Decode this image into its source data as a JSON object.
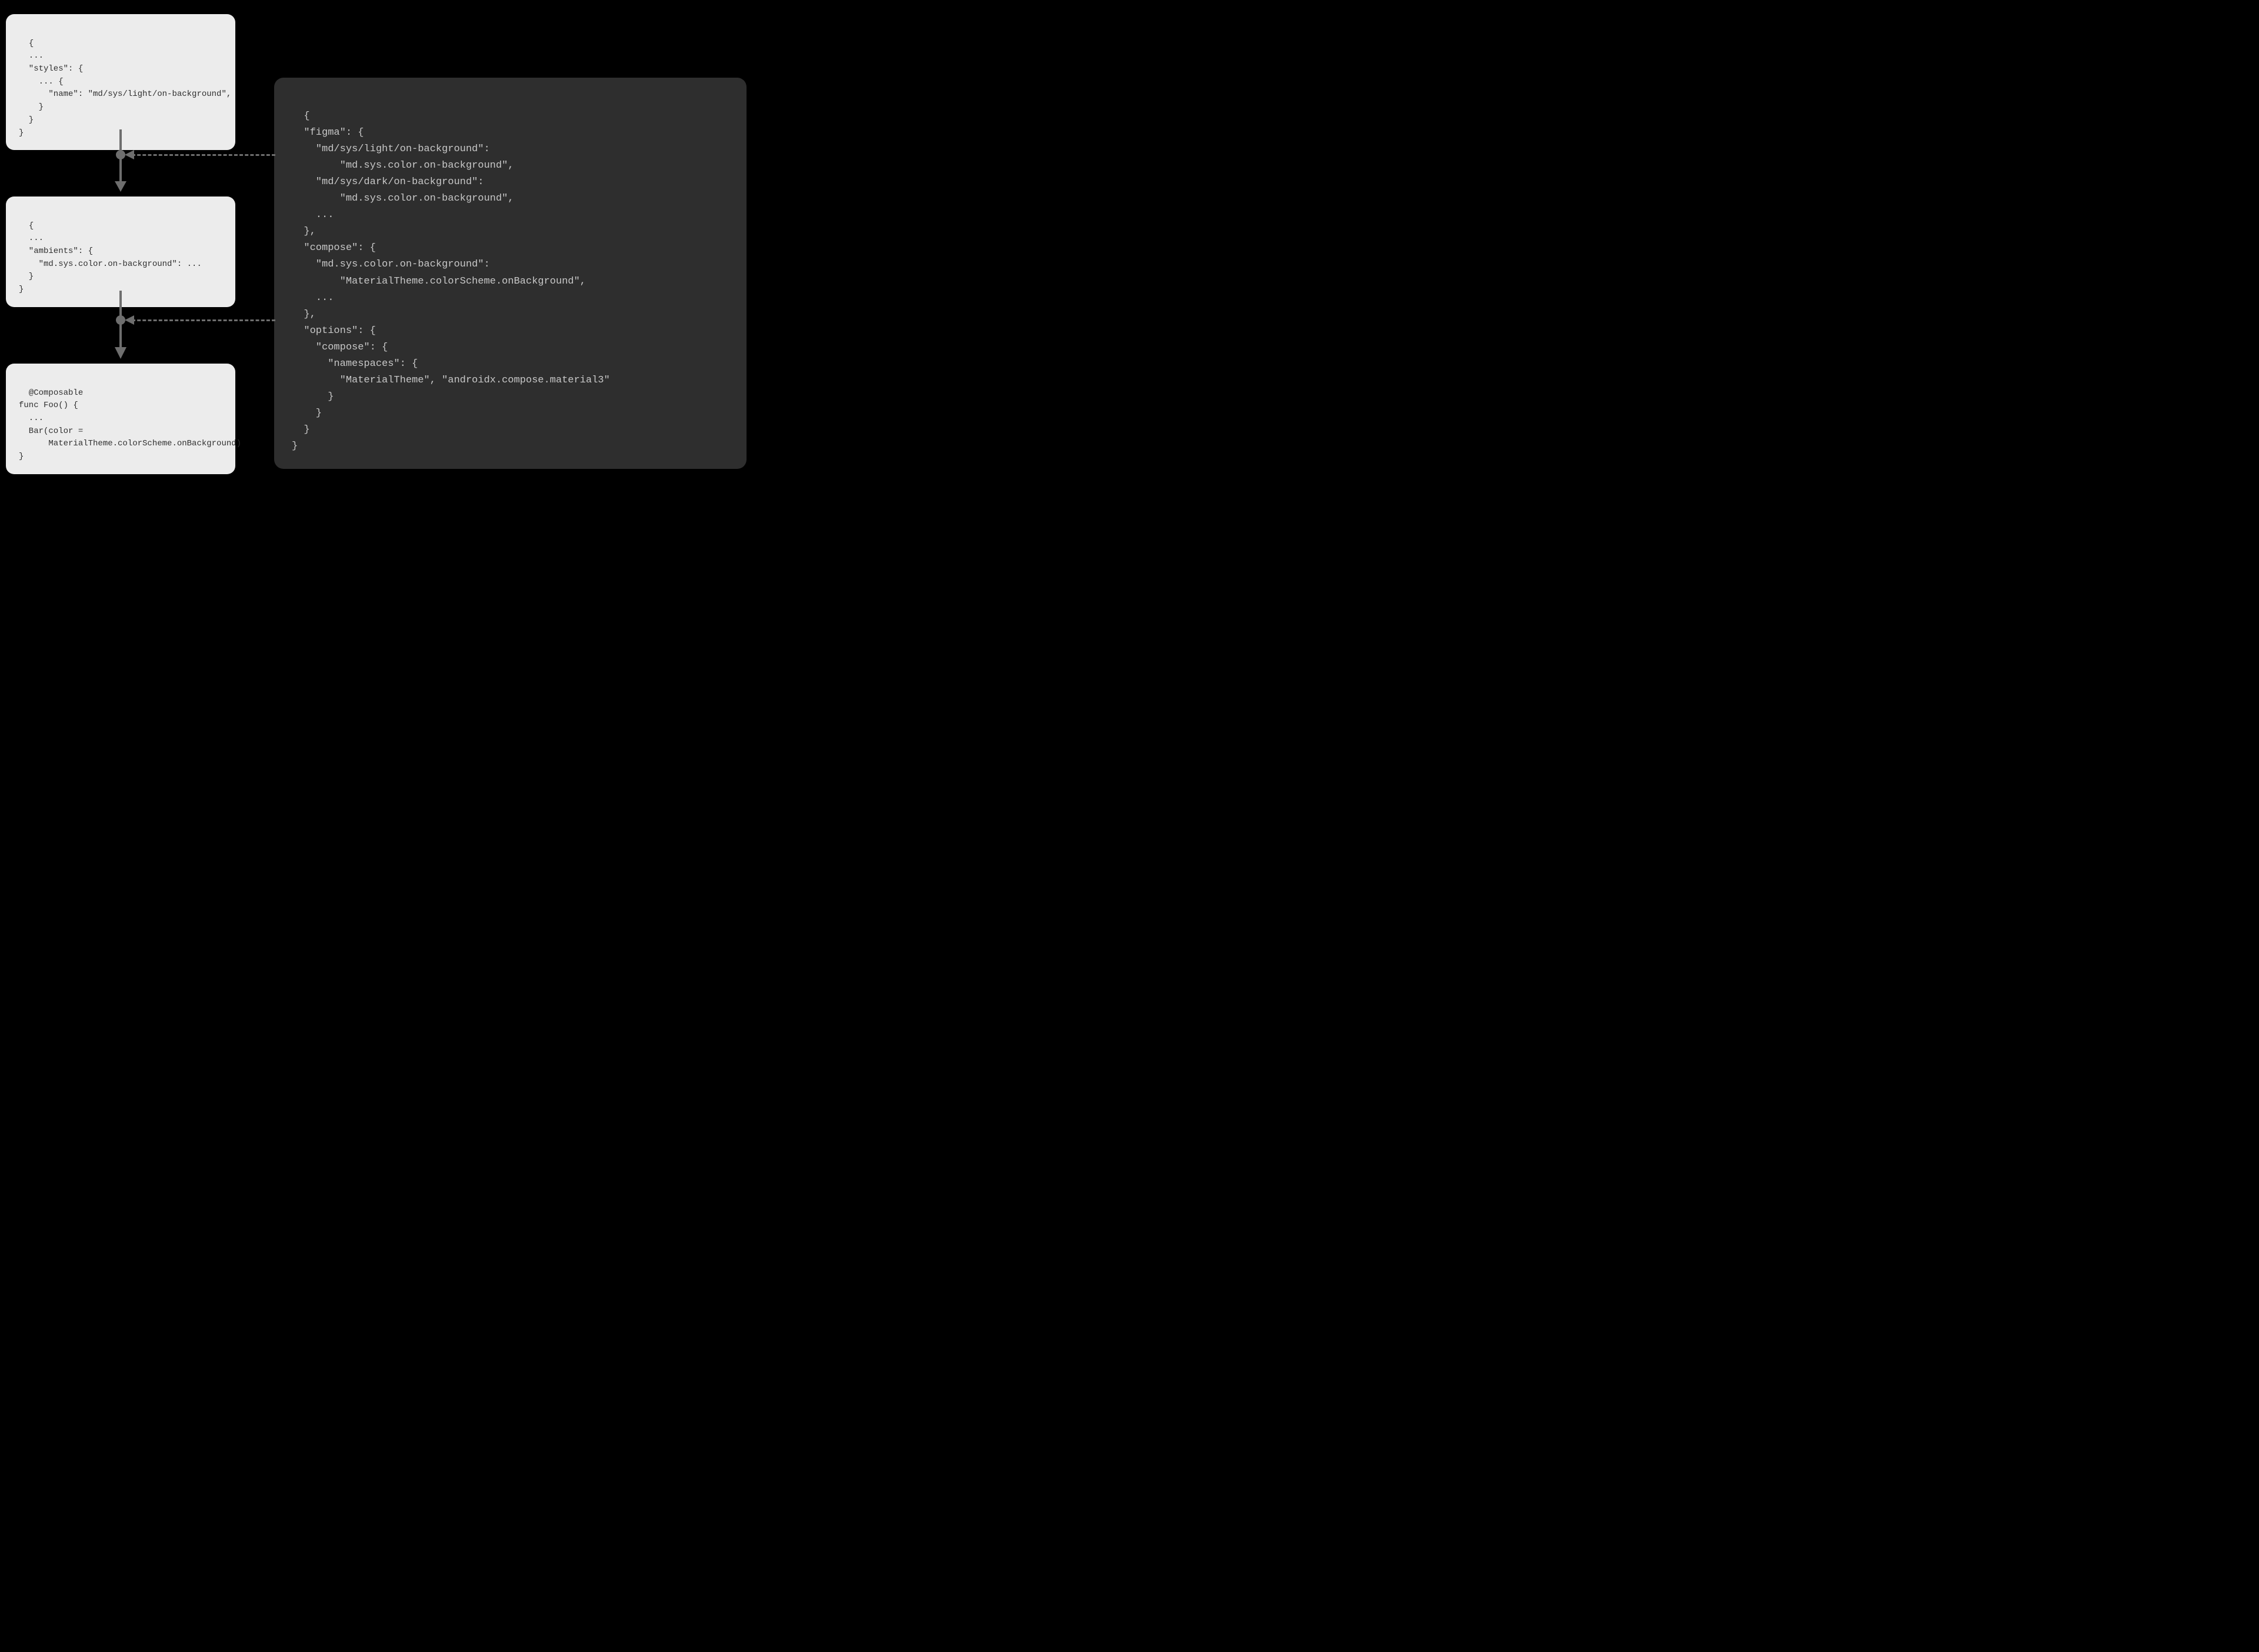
{
  "cards": {
    "styles": "{\n  ...\n  \"styles\": {\n    ... {\n      \"name\": \"md/sys/light/on-background\",\n    }\n  }\n}",
    "ambients": "{\n  ...\n  \"ambients\": {\n    \"md.sys.color.on-background\": ...\n  }\n}",
    "composable": "@Composable\nfunc Foo() {\n  ...\n  Bar(color =\n      MaterialTheme.colorScheme.onBackground)\n}",
    "mapping": "{\n  \"figma\": {\n    \"md/sys/light/on-background\":\n        \"md.sys.color.on-background\",\n    \"md/sys/dark/on-background\":\n        \"md.sys.color.on-background\",\n    ...\n  },\n  \"compose\": {\n    \"md.sys.color.on-background\":\n        \"MaterialTheme.colorScheme.onBackground\",\n    ...\n  },\n  \"options\": {\n    \"compose\": {\n      \"namespaces\": {\n        \"MaterialTheme\", \"androidx.compose.material3\"\n      }\n    }\n  }\n}"
  },
  "colors": {
    "page_bg": "#000000",
    "light_card_bg": "#ececec",
    "light_card_text": "#2f2f2f",
    "dark_card_bg": "#2e2e2e",
    "dark_card_text": "#c8c8c8",
    "arrow": "#6e6e6e"
  }
}
